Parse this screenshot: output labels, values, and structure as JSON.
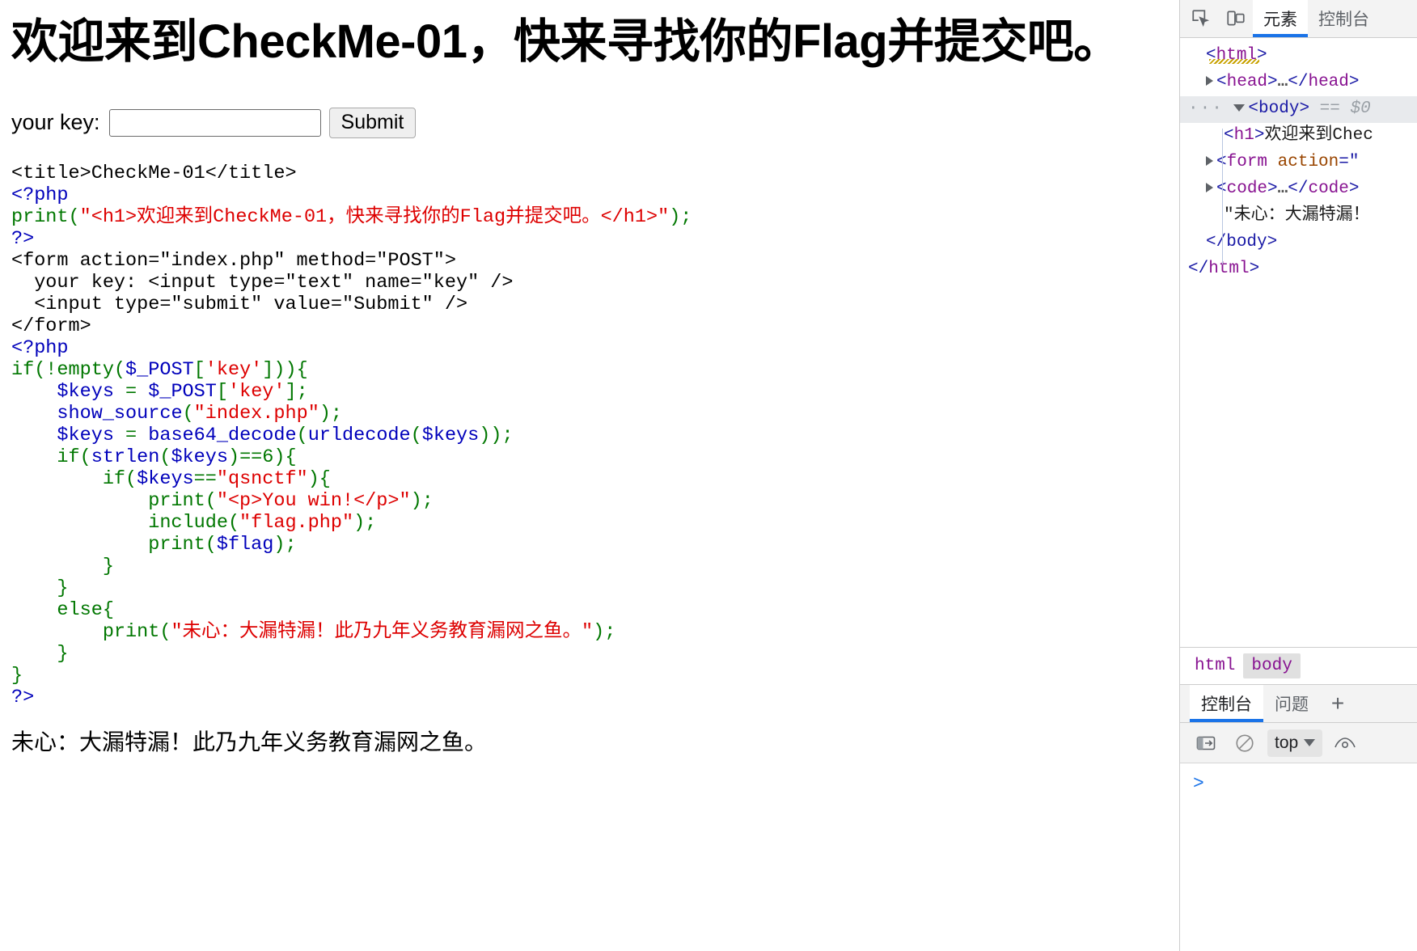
{
  "page": {
    "heading": "欢迎来到CheckMe-01，快来寻找你的Flag并提交吧。",
    "form": {
      "label": "your key:",
      "input_value": "",
      "input_placeholder": "",
      "submit_label": "Submit"
    },
    "output_text": "未心：大漏特漏！此乃九年义务教育漏网之鱼。",
    "source_lines": [
      [
        {
          "t": "<title>CheckMe-01</title>",
          "c": "c-html"
        }
      ],
      [
        {
          "t": "<?php",
          "c": "c-php"
        }
      ],
      [
        {
          "t": "print(",
          "c": "c-kw"
        },
        {
          "t": "\"<h1>欢迎来到CheckMe-01，快来寻找你的Flag并提交吧。</h1>\"",
          "c": "c-str"
        },
        {
          "t": ");",
          "c": "c-kw"
        }
      ],
      [
        {
          "t": "?>",
          "c": "c-php"
        }
      ],
      [
        {
          "t": "<form action=\"index.php\" method=\"POST\">",
          "c": "c-html"
        }
      ],
      [
        {
          "t": "  your key: <input type=\"text\" name=\"key\" />",
          "c": "c-html"
        }
      ],
      [
        {
          "t": "  <input type=\"submit\" value=\"Submit\" />",
          "c": "c-html"
        }
      ],
      [
        {
          "t": "</form>",
          "c": "c-html"
        }
      ],
      [
        {
          "t": "<?php",
          "c": "c-php"
        }
      ],
      [
        {
          "t": "if(!empty(",
          "c": "c-kw"
        },
        {
          "t": "$_POST",
          "c": "c-var"
        },
        {
          "t": "[",
          "c": "c-kw"
        },
        {
          "t": "'key'",
          "c": "c-str"
        },
        {
          "t": "])){",
          "c": "c-kw"
        }
      ],
      [
        {
          "t": "    ",
          "c": "c-kw"
        },
        {
          "t": "$keys",
          "c": "c-var"
        },
        {
          "t": " = ",
          "c": "c-kw"
        },
        {
          "t": "$_POST",
          "c": "c-var"
        },
        {
          "t": "[",
          "c": "c-kw"
        },
        {
          "t": "'key'",
          "c": "c-str"
        },
        {
          "t": "];",
          "c": "c-kw"
        }
      ],
      [
        {
          "t": "    ",
          "c": "c-kw"
        },
        {
          "t": "show_source",
          "c": "c-var"
        },
        {
          "t": "(",
          "c": "c-kw"
        },
        {
          "t": "\"index.php\"",
          "c": "c-str"
        },
        {
          "t": ");",
          "c": "c-kw"
        }
      ],
      [
        {
          "t": "    ",
          "c": "c-kw"
        },
        {
          "t": "$keys",
          "c": "c-var"
        },
        {
          "t": " = ",
          "c": "c-kw"
        },
        {
          "t": "base64_decode",
          "c": "c-var"
        },
        {
          "t": "(",
          "c": "c-kw"
        },
        {
          "t": "urldecode",
          "c": "c-var"
        },
        {
          "t": "(",
          "c": "c-kw"
        },
        {
          "t": "$keys",
          "c": "c-var"
        },
        {
          "t": "));",
          "c": "c-kw"
        }
      ],
      [
        {
          "t": "    if(",
          "c": "c-kw"
        },
        {
          "t": "strlen",
          "c": "c-var"
        },
        {
          "t": "(",
          "c": "c-kw"
        },
        {
          "t": "$keys",
          "c": "c-var"
        },
        {
          "t": ")==6){",
          "c": "c-kw"
        }
      ],
      [
        {
          "t": "        if(",
          "c": "c-kw"
        },
        {
          "t": "$keys",
          "c": "c-var"
        },
        {
          "t": "==",
          "c": "c-kw"
        },
        {
          "t": "\"qsnctf\"",
          "c": "c-str"
        },
        {
          "t": "){",
          "c": "c-kw"
        }
      ],
      [
        {
          "t": "            print(",
          "c": "c-kw"
        },
        {
          "t": "\"<p>You win!</p>\"",
          "c": "c-str"
        },
        {
          "t": ");",
          "c": "c-kw"
        }
      ],
      [
        {
          "t": "            include(",
          "c": "c-kw"
        },
        {
          "t": "\"flag.php\"",
          "c": "c-str"
        },
        {
          "t": ");",
          "c": "c-kw"
        }
      ],
      [
        {
          "t": "            print(",
          "c": "c-kw"
        },
        {
          "t": "$flag",
          "c": "c-var"
        },
        {
          "t": ");",
          "c": "c-kw"
        }
      ],
      [
        {
          "t": "        }",
          "c": "c-kw"
        }
      ],
      [
        {
          "t": "    }",
          "c": "c-kw"
        }
      ],
      [
        {
          "t": "    else{",
          "c": "c-kw"
        }
      ],
      [
        {
          "t": "        print(",
          "c": "c-kw"
        },
        {
          "t": "\"未心：大漏特漏！此乃九年义务教育漏网之鱼。\"",
          "c": "c-str"
        },
        {
          "t": ");",
          "c": "c-kw"
        }
      ],
      [
        {
          "t": "    }",
          "c": "c-kw"
        }
      ],
      [
        {
          "t": "}",
          "c": "c-kw"
        }
      ],
      [
        {
          "t": "?>",
          "c": "c-php"
        }
      ]
    ]
  },
  "devtools": {
    "toolbar": {
      "inspect_icon": "inspect-element-icon",
      "device_icon": "device-toolbar-icon",
      "tabs": [
        {
          "label": "元素",
          "active": true
        },
        {
          "label": "控制台",
          "active": false
        }
      ]
    },
    "dom_rows": [
      {
        "indent": 1,
        "html": "<span class=\"tag-b\">&lt;</span><span class=\"tag-p\">html</span><span class=\"tag-b\">&gt;</span>"
      },
      {
        "indent": 1,
        "html": "<span class=\"tri\"></span><span class=\"tag-b\">&lt;</span><span class=\"tag-p\">head</span><span class=\"tag-b\">&gt;</span><span class=\"ellip\">…</span><span class=\"tag-b\">&lt;/</span><span class=\"tag-p\">head</span><span class=\"tag-b\">&gt;</span>"
      },
      {
        "indent": 0,
        "selected": true,
        "html": "<span class=\"dots\">···</span> <span class=\"tri open\"></span><span class=\"tag-b\">&lt;</span><span class=\"tag-b\">body</span><span class=\"tag-b\">&gt;</span> <span class=\"eq0\">== $0</span>"
      },
      {
        "indent": 2,
        "html": "<span class=\"tag-b\">&lt;</span><span class=\"tag-p\">h1</span><span class=\"tag-b\">&gt;</span><span class=\"txt-n\">欢迎来到Chec</span>"
      },
      {
        "indent": 1,
        "html": "<span class=\"tri\"></span><span class=\"tag-b\">&lt;</span><span class=\"tag-p\">form</span> <span class=\"attr-n\">action</span><span class=\"tag-b\">=\"</span>"
      },
      {
        "indent": 1,
        "html": "<span class=\"tri\"></span><span class=\"tag-b\">&lt;</span><span class=\"tag-p\">code</span><span class=\"tag-b\">&gt;</span><span class=\"ellip\">…</span><span class=\"tag-b\">&lt;/</span><span class=\"tag-p\">code</span><span class=\"tag-b\">&gt;</span>"
      },
      {
        "indent": 2,
        "html": "<span class=\"txt-n\">\"未心：大漏特漏！</span>"
      },
      {
        "indent": 1,
        "html": "<span class=\"tag-b\">&lt;/</span><span class=\"tag-b\">body</span><span class=\"tag-b\">&gt;</span>"
      },
      {
        "indent": 0,
        "html": "<span class=\"tag-b\">&lt;/</span><span class=\"tag-p\">html</span><span class=\"tag-b\">&gt;</span>"
      }
    ],
    "breadcrumb": [
      {
        "label": "html",
        "active": false
      },
      {
        "label": "body",
        "active": true
      }
    ],
    "drawer": {
      "tabs": [
        {
          "label": "控制台",
          "active": true
        },
        {
          "label": "问题",
          "active": false
        }
      ],
      "add_label": "+",
      "console_toolbar": {
        "sidebar_icon": "console-sidebar-icon",
        "clear_icon": "clear-console-icon",
        "context": "top",
        "eye_icon": "live-expression-eye-icon"
      },
      "prompt": ">"
    }
  }
}
